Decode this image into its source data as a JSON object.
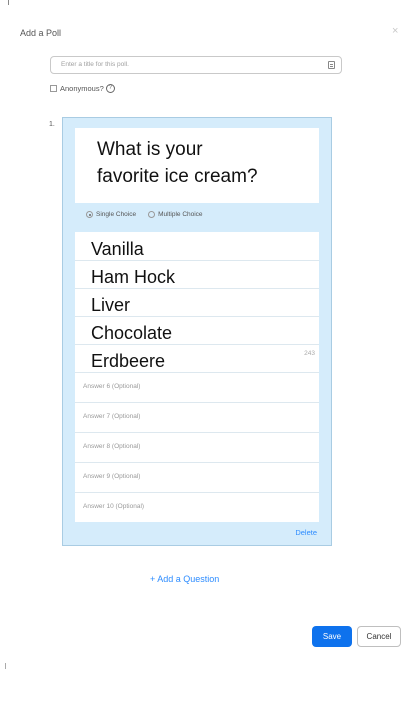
{
  "dialog": {
    "title": "Add a Poll",
    "close_glyph": "×",
    "title_placeholder": "Enter a title for this poll.",
    "anonymous_label": "Anonymous?",
    "help_glyph": "?"
  },
  "question": {
    "number": "1.",
    "text_line1": "What is your",
    "text_line2": "favorite ice cream?",
    "single_choice": "Single Choice",
    "multiple_choice": "Multiple Choice",
    "selected_type": "Single Choice",
    "answers": [
      "Vanilla",
      "Ham Hock",
      "Liver",
      "Chocolate",
      "Erdbeere"
    ],
    "char_counter": "243",
    "optional_answers": [
      "Answer 6 (Optional)",
      "Answer 7 (Optional)",
      "Answer 8 (Optional)",
      "Answer 9 (Optional)",
      "Answer 10 (Optional)"
    ],
    "delete_label": "Delete"
  },
  "actions": {
    "add_question": "+ Add a Question",
    "save": "Save",
    "cancel": "Cancel"
  },
  "colors": {
    "accent": "#0e72ed",
    "link": "#2d8cff",
    "card_bg": "#d5ecfb"
  },
  "icons": [
    "close-icon",
    "keyboard-icon",
    "help-icon"
  ]
}
